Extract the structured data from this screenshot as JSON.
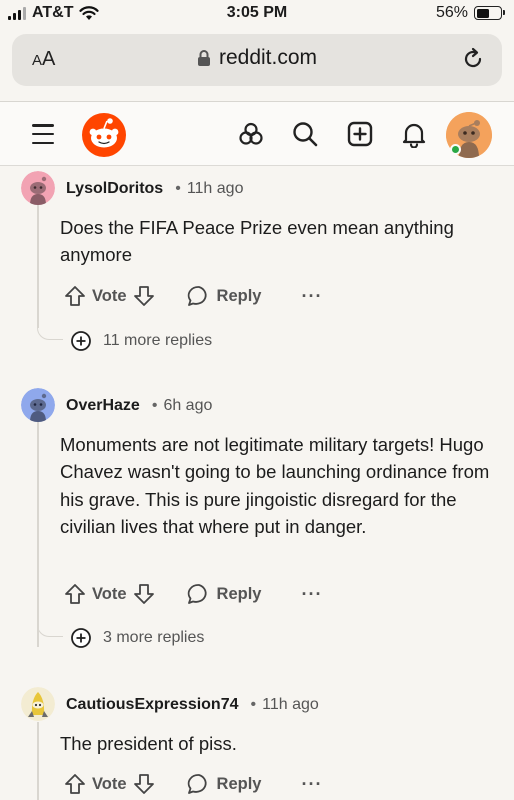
{
  "status_bar": {
    "carrier": "AT&T",
    "time": "3:05 PM",
    "battery": "56%",
    "battery_fraction": 0.56
  },
  "browser": {
    "aa_label": "AA",
    "url": "reddit.com"
  },
  "header": {
    "icons": [
      "menu-icon",
      "reddit-logo",
      "explore-icon",
      "search-icon",
      "create-post-icon",
      "notifications-icon",
      "user-avatar"
    ]
  },
  "comments": [
    {
      "username": "LysolDoritos",
      "time": "11h ago",
      "body": "Does the FIFA Peace Prize even mean anything anymore",
      "vote_label": "Vote",
      "reply_label": "Reply",
      "more_replies": "11 more replies"
    },
    {
      "username": "OverHaze",
      "time": "6h ago",
      "body": "Monuments are not legitimate military targets! Hugo Chavez wasn't going to be launching ordinance from his grave. This is pure jingoistic disregard for the civilian lives that where put in danger.",
      "vote_label": "Vote",
      "reply_label": "Reply",
      "more_replies": "3 more replies"
    },
    {
      "username": "CautiousExpression74",
      "time": "11h ago",
      "body": "The president of piss.",
      "vote_label": "Vote",
      "reply_label": "Reply"
    }
  ],
  "colors": {
    "background": "#f7f5f1",
    "reddit_orange": "#ff4500",
    "online_green": "#2aa845",
    "avatar1": "#f2a3b3",
    "avatar2": "#8fa8ec",
    "avatar3": "#f3ecd2"
  }
}
